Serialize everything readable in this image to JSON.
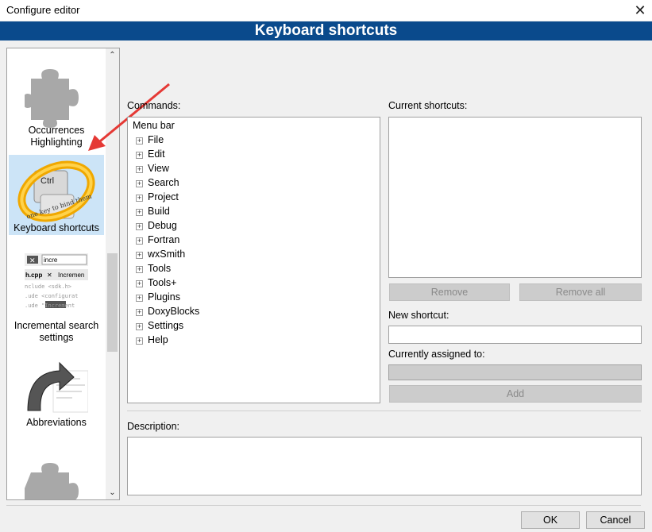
{
  "window": {
    "title": "Configure editor",
    "close_glyph": "✕"
  },
  "banner": {
    "title": "Keyboard shortcuts"
  },
  "categories": {
    "items": [
      {
        "label_line1": "Occurrences",
        "label_line2": "Highlighting",
        "icon": "puzzle-icon"
      },
      {
        "label_line1": "Keyboard shortcuts",
        "icon": "keyboard-ring-icon",
        "selected": true
      },
      {
        "label_line1": "Incremental search",
        "label_line2": "settings",
        "icon": "incremental-search-icon"
      },
      {
        "label_line1": "Abbreviations",
        "icon": "abbreviations-icon"
      },
      {
        "label_line1": "",
        "icon": "puzzle-icon"
      }
    ],
    "scroll_up": "⌃",
    "scroll_down": "⌄"
  },
  "incsearch_thumb": {
    "search_text": "incre",
    "tab1": "h.cpp",
    "tab2": "Incremen",
    "code1": "nclude <sdk.h>",
    "code2": ".ude <configurat",
    "code3": ".ude \"Increment"
  },
  "keyboard_thumb": {
    "key": "Ctrl",
    "ring_text": "one key to bind them"
  },
  "commands": {
    "label": "Commands:",
    "root": "Menu bar",
    "expander": "+",
    "nodes": [
      "File",
      "Edit",
      "View",
      "Search",
      "Project",
      "Build",
      "Debug",
      "Fortran",
      "wxSmith",
      "Tools",
      "Tools+",
      "Plugins",
      "DoxyBlocks",
      "Settings",
      "Help"
    ]
  },
  "current_shortcuts": {
    "label": "Current shortcuts:"
  },
  "buttons": {
    "remove": "Remove",
    "remove_all": "Remove all",
    "add": "Add",
    "ok": "OK",
    "cancel": "Cancel"
  },
  "new_shortcut": {
    "label": "New shortcut:",
    "value": ""
  },
  "currently_assigned": {
    "label": "Currently assigned to:",
    "value": ""
  },
  "description": {
    "label": "Description:",
    "value": ""
  },
  "colors": {
    "banner": "#0a4a8c",
    "selected": "#cce4f7",
    "arrow": "#e53935"
  }
}
